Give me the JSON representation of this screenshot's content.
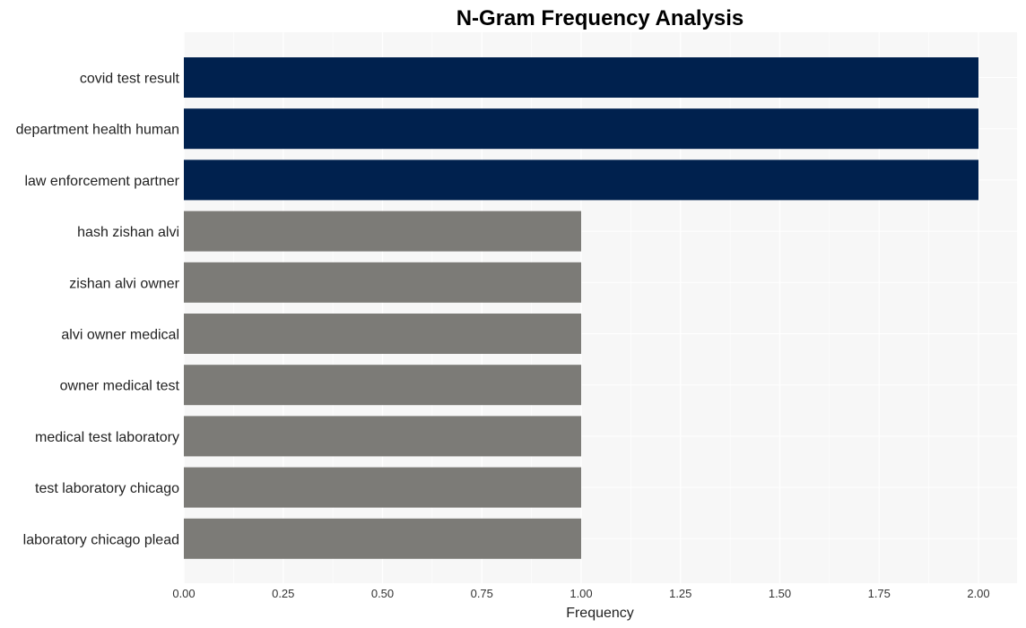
{
  "chart_data": {
    "type": "bar",
    "orientation": "horizontal",
    "title": "N-Gram Frequency Analysis",
    "xlabel": "Frequency",
    "ylabel": "",
    "xlim": [
      0,
      2.1
    ],
    "x_ticks": [
      "0.00",
      "0.25",
      "0.50",
      "0.75",
      "1.00",
      "1.25",
      "1.50",
      "1.75",
      "2.00"
    ],
    "x_tick_values": [
      0,
      0.25,
      0.5,
      0.75,
      1.0,
      1.25,
      1.5,
      1.75,
      2.0
    ],
    "grid": true,
    "categories": [
      "covid test result",
      "department health human",
      "law enforcement partner",
      "hash zishan alvi",
      "zishan alvi owner",
      "alvi owner medical",
      "owner medical test",
      "medical test laboratory",
      "test laboratory chicago",
      "laboratory chicago plead"
    ],
    "values": [
      2,
      2,
      2,
      1,
      1,
      1,
      1,
      1,
      1,
      1
    ],
    "colors": {
      "high": "#00214e",
      "low": "#7c7b77",
      "plot_background": "#f7f7f7",
      "grid": "#ffffff"
    }
  }
}
